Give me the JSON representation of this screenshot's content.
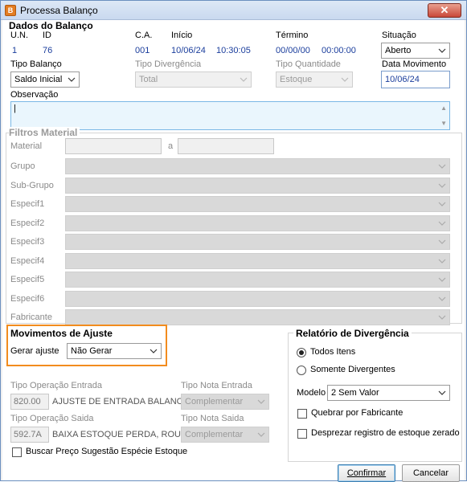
{
  "window": {
    "title": "Processa Balanço",
    "icon": "app-icon",
    "close_glyph": "✕"
  },
  "dados_balanco": {
    "title": "Dados do Balanço",
    "un_label": "U.N.",
    "un_value": "1",
    "id_label": "ID",
    "id_value": "76",
    "ca_label": "C.A.",
    "ca_value": "001",
    "inicio_label": "Início",
    "inicio_date": "10/06/24",
    "inicio_time": "10:30:05",
    "termino_label": "Término",
    "termino_date": "00/00/00",
    "termino_time": "00:00:00",
    "situacao_label": "Situação",
    "situacao_value": "Aberto",
    "tipo_balanco_label": "Tipo Balanço",
    "tipo_balanco_value": "Saldo Inicial",
    "tipo_divergencia_label": "Tipo Divergência",
    "tipo_divergencia_value": "Total",
    "tipo_quantidade_label": "Tipo Quantidade",
    "tipo_quantidade_value": "Estoque",
    "data_movimento_label": "Data Movimento",
    "data_movimento_value": "10/06/24",
    "observacao_label": "Observação",
    "observacao_value": "|"
  },
  "filtros": {
    "title": "Filtros Material",
    "material_label": "Material",
    "a_label": "a",
    "rows": [
      "Grupo",
      "Sub-Grupo",
      "Especif1",
      "Especif2",
      "Especif3",
      "Especif4",
      "Especif5",
      "Especif6",
      "Fabricante"
    ]
  },
  "movimentos": {
    "title": "Movimentos de Ajuste",
    "gerar_ajuste_label": "Gerar ajuste",
    "gerar_ajuste_value": "Não Gerar",
    "tipo_op_entrada_label": "Tipo Operação Entrada",
    "tipo_op_entrada_code": "820.00",
    "tipo_op_entrada_desc": "AJUSTE DE ENTRADA BALANCO",
    "tipo_nota_entrada_label": "Tipo Nota Entrada",
    "tipo_nota_entrada_value": "Complementar",
    "tipo_op_saida_label": "Tipo Operação Saida",
    "tipo_op_saida_code": "592.7A",
    "tipo_op_saida_desc": "BAIXA ESTOQUE PERDA, ROUBO",
    "tipo_nota_saida_label": "Tipo Nota Saida",
    "tipo_nota_saida_value": "Complementar",
    "buscar_preco_label": "Buscar Preço Sugestão Espécie Estoque"
  },
  "relatorio": {
    "title": "Relatório de Divergência",
    "todos_label": "Todos Itens",
    "somente_label": "Somente Divergentes",
    "modelo_label": "Modelo",
    "modelo_value": "2 Sem Valor",
    "quebrar_label": "Quebrar por Fabricante",
    "desprezar_label": "Desprezar registro de estoque zerado"
  },
  "buttons": {
    "confirmar": "Confirmar",
    "cancelar": "Cancelar"
  },
  "colors": {
    "highlight_border": "#f28c1e",
    "value_text": "#1a3d9c"
  }
}
